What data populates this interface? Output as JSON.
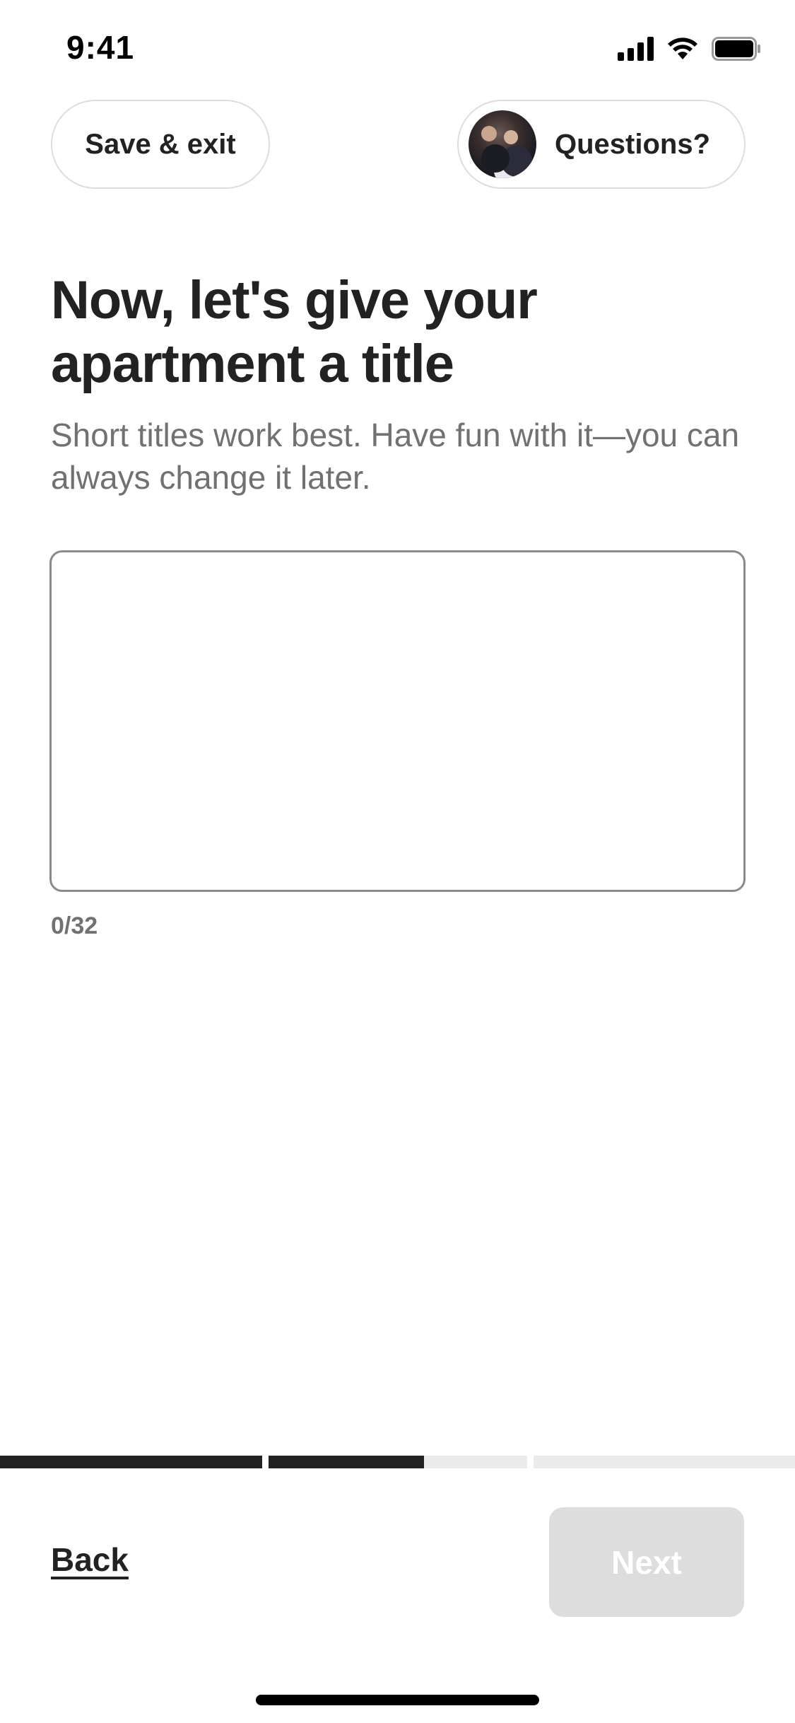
{
  "status_bar": {
    "time": "9:41",
    "icons": [
      "cellular-signal-icon",
      "wifi-icon",
      "battery-icon"
    ]
  },
  "header": {
    "save_exit_label": "Save & exit",
    "questions_label": "Questions?"
  },
  "main": {
    "heading": "Now, let's give your apartment a title",
    "subtitle": "Short titles work best. Have fun with it—you can always change it later.",
    "title_input": {
      "value": "",
      "placeholder": ""
    },
    "char_count": "0/32"
  },
  "progress": {
    "segments": [
      {
        "fill": 1.0
      },
      {
        "fill": 0.6
      },
      {
        "fill": 0.0
      }
    ],
    "colors": {
      "filled": "#222222",
      "track": "#ebebeb"
    }
  },
  "footer": {
    "back_label": "Back",
    "next_label": "Next"
  }
}
